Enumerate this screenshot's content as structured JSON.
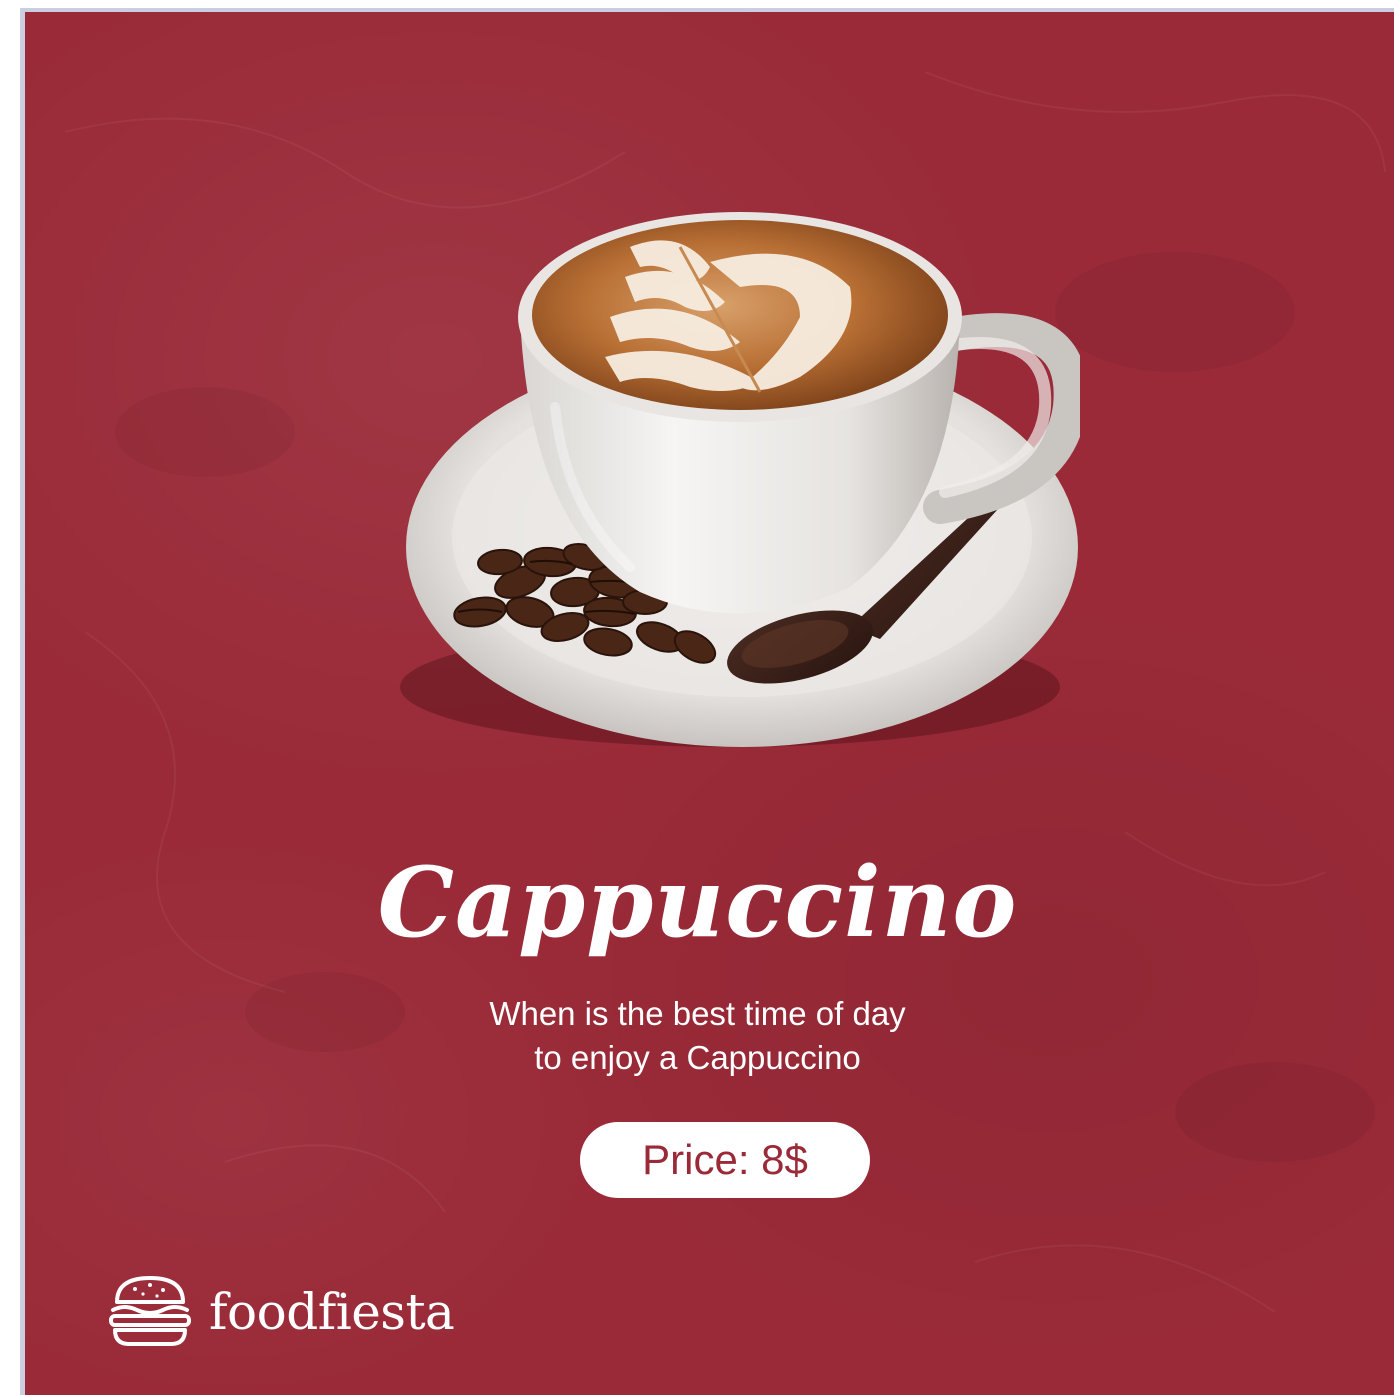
{
  "product": {
    "name": "Cappuccino",
    "tagline_line1": "When is the best time of day",
    "tagline_line2": "to enjoy a Cappuccino",
    "price_label": "Price: 8$"
  },
  "brand": {
    "name": "foodfiesta",
    "logo_icon": "burger-icon"
  },
  "colors": {
    "background": "#9a2a38",
    "text": "#ffffff",
    "pill_background": "#ffffff",
    "pill_text": "#9a2a38"
  },
  "illustration": {
    "subject": "coffee-cup-icon"
  }
}
